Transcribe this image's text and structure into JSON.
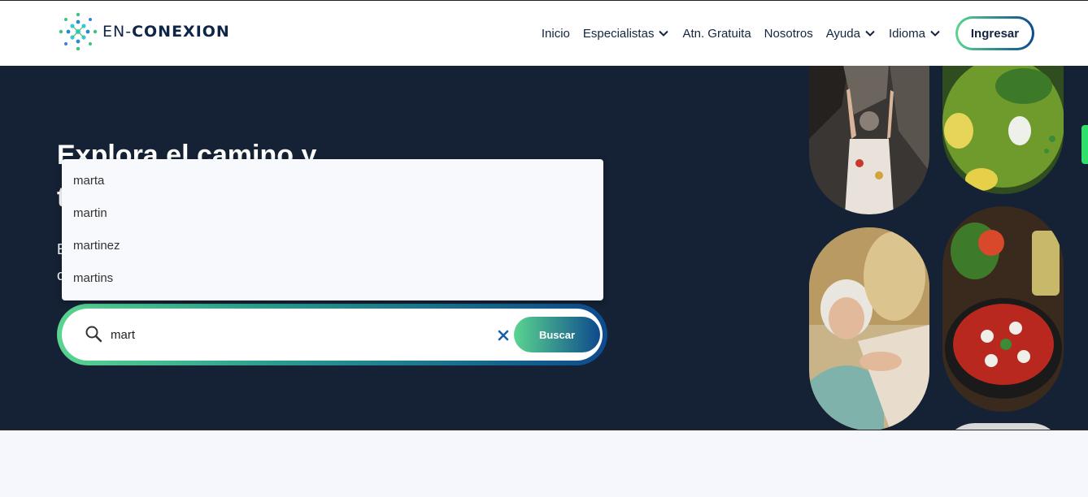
{
  "brand": {
    "logo_text_light": "EN-",
    "logo_text_bold": "CONEXION"
  },
  "nav": {
    "items": [
      {
        "label": "Inicio",
        "dropdown": false
      },
      {
        "label": "Especialistas",
        "dropdown": true
      },
      {
        "label": "Atn. Gratuita",
        "dropdown": false
      },
      {
        "label": "Nosotros",
        "dropdown": false
      },
      {
        "label": "Ayuda",
        "dropdown": true
      },
      {
        "label": "Idioma",
        "dropdown": true
      }
    ],
    "login_label": "Ingresar"
  },
  "hero": {
    "title_line1": "Explora el camino y",
    "title_line2": "t",
    "sub_line1": "E",
    "sub_line2": "c"
  },
  "search": {
    "value": "mart",
    "button_label": "Buscar",
    "suggestions": [
      "marta",
      "martin",
      "martinez",
      "martins"
    ]
  },
  "colors": {
    "header_bg": "#ffffff",
    "hero_bg": "#152235",
    "gradient_start": "#5ad48f",
    "gradient_end": "#0d4a8e",
    "text_dark": "#14243e"
  },
  "icons": [
    "logo-icon",
    "chevron-down-icon",
    "search-icon",
    "close-icon"
  ]
}
